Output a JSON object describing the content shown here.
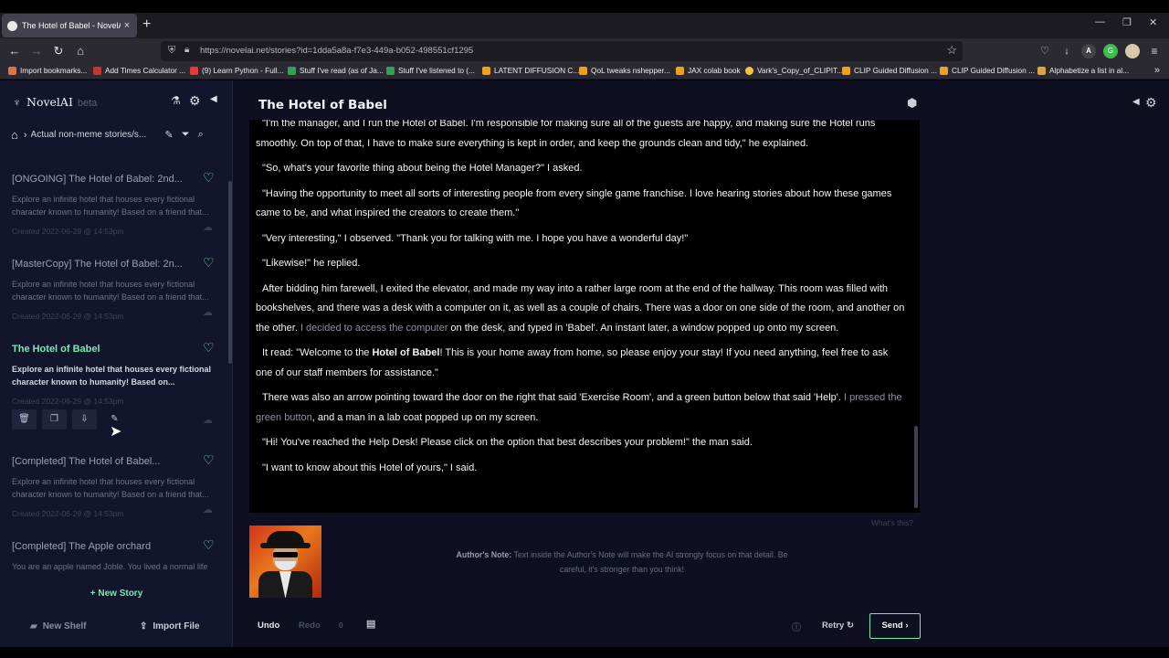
{
  "browser": {
    "tab_title": "The Hotel of Babel - NovelAI",
    "tab_close": "×",
    "new_tab": "+",
    "url": "https://novelai.net/stories?id=1dda5a8a-f7e3-449a-b052-498551cf1295",
    "window_controls": [
      "—",
      "❐",
      "✕"
    ],
    "nav_icons": [
      "back-icon",
      "forward-icon",
      "reload-icon",
      "home-icon"
    ],
    "bookmarks": [
      {
        "label": "Import bookmarks...",
        "color": "#e0763a"
      },
      {
        "label": "Add Times Calculator ...",
        "color": "#c0392b"
      },
      {
        "label": "(9) Learn Python - Full...",
        "color": "#e53935"
      },
      {
        "label": "Stuff I've read (as of Ja...",
        "color": "#2ea44f"
      },
      {
        "label": "Stuff I've listened to (...",
        "color": "#2ea44f"
      },
      {
        "label": "LATENT DIFFUSION C...",
        "color": "#f0a020"
      },
      {
        "label": "QoL tweaks nshepper...",
        "color": "#f0a020"
      },
      {
        "label": "JAX colab book",
        "color": "#f0a020"
      },
      {
        "label": "Vark's_Copy_of_CLIPIT...",
        "color": "#f5c542"
      },
      {
        "label": "CLIP Guided Diffusion ...",
        "color": "#f0a020"
      },
      {
        "label": "CLIP Guided Diffusion ...",
        "color": "#f0a020"
      },
      {
        "label": "Alphabetize a list in al...",
        "color": "#d9a441"
      }
    ]
  },
  "app": {
    "brand_name": "NovelAI",
    "brand_beta": "beta",
    "breadcrumb_path": "Actual non-meme stories/s...",
    "story_list": [
      {
        "title": "[ONGOING] The Hotel of Babel: 2nd...",
        "desc": "Explore an infinite hotel that houses every fictional character known to humanity! Based on a friend that...",
        "date": "Created 2022-06-29 @ 14:53pm",
        "active": false
      },
      {
        "title": "[MasterCopy] The Hotel of Babel: 2n...",
        "desc": "Explore an infinite hotel that houses every fictional character known to humanity! Based on a friend that...",
        "date": "Created 2022-06-29 @ 14:53pm",
        "active": false
      },
      {
        "title": "The Hotel of Babel",
        "desc": "Explore an infinite hotel that houses every fictional character known to humanity! Based on...",
        "date": "Created 2022-06-29 @ 14:53pm",
        "active": true
      },
      {
        "title": "[Completed] The Hotel of Babel...",
        "desc": "Explore an infinite hotel that houses every fictional character known to humanity! Based on a friend that...",
        "date": "Created 2022-06-29 @ 14:53pm",
        "active": false
      },
      {
        "title": "[Completed] The Apple orchard",
        "desc": "You are an apple named Joble. You lived a normal life",
        "date": "",
        "active": false
      }
    ],
    "new_story": "New Story",
    "new_shelf": "New Shelf",
    "import_file": "Import File",
    "story_title": "The Hotel of Babel",
    "story_paragraphs": [
      {
        "parts": [
          {
            "t": "\"I'm the manager, and I run the Hotel of Babel. I'm responsible for making sure all of the guests are happy, and making sure the Hotel runs smoothly. On top of that, I have to make sure everything is kept in order, and keep the grounds clean and tidy,\" he explained.",
            "s": "n"
          }
        ]
      },
      {
        "parts": [
          {
            "t": "\"So, what's your favorite thing about being the Hotel Manager?\" I asked.",
            "s": "n"
          }
        ]
      },
      {
        "parts": [
          {
            "t": "\"Having the opportunity to meet all sorts of interesting people from every single game franchise. I love hearing stories about how these games came to be, and what inspired the creators to create them.\"",
            "s": "n"
          }
        ]
      },
      {
        "parts": [
          {
            "t": "\"Very interesting,\" I observed. \"Thank you for talking with me. I hope you have a wonderful day!\"",
            "s": "n"
          }
        ]
      },
      {
        "parts": [
          {
            "t": "\"Likewise!\" he replied.",
            "s": "n"
          }
        ]
      },
      {
        "parts": [
          {
            "t": "After bidding him farewell, I exited the elevator, and made my way into a rather large room at the end of the hallway. This room was filled with bookshelves, and there was a desk with a computer on it, as well as a couple of chairs. There was a door on one side of the room, and another on the other. ",
            "s": "n"
          },
          {
            "t": "I decided to access the computer",
            "s": "d"
          },
          {
            "t": " on the desk, and typed in 'Babel'. An instant later, a window popped up onto my screen.",
            "s": "n"
          }
        ]
      },
      {
        "parts": [
          {
            "t": "It read: \"Welcome to the ",
            "s": "n"
          },
          {
            "t": "Hotel of Babel",
            "s": "b"
          },
          {
            "t": "! This is your home away from home, so please enjoy your stay! If you need anything, feel free to ask one of our staff members for assistance.\"",
            "s": "n"
          }
        ]
      },
      {
        "parts": [
          {
            "t": "There was also an arrow pointing toward the door on the right that said 'Exercise Room', and a green button below that said 'Help'. ",
            "s": "n"
          },
          {
            "t": "I pressed the green button",
            "s": "d"
          },
          {
            "t": ", and a man in a lab coat popped up on my screen.",
            "s": "n"
          }
        ]
      },
      {
        "parts": [
          {
            "t": "\"Hi! You've reached the Help Desk! Please click on the option that best describes your problem!\" the man said.",
            "s": "n"
          }
        ]
      },
      {
        "parts": [
          {
            "t": "\"I want to know about this Hotel of yours,\" I said.",
            "s": "n"
          }
        ]
      }
    ],
    "whats_this": "What's this?",
    "authors_note_label": "Author's Note:",
    "authors_note_text": " Text inside the Author's Note will make the AI strongly focus on that detail. Be careful, it's stronger than you think!",
    "undo": "Undo",
    "redo": "Redo",
    "history_count": "0",
    "retry": "Retry",
    "send": "Send",
    "colors": {
      "accent": "#78e7b3",
      "background": "#0e0f21",
      "sidebar": "#13152c"
    }
  }
}
